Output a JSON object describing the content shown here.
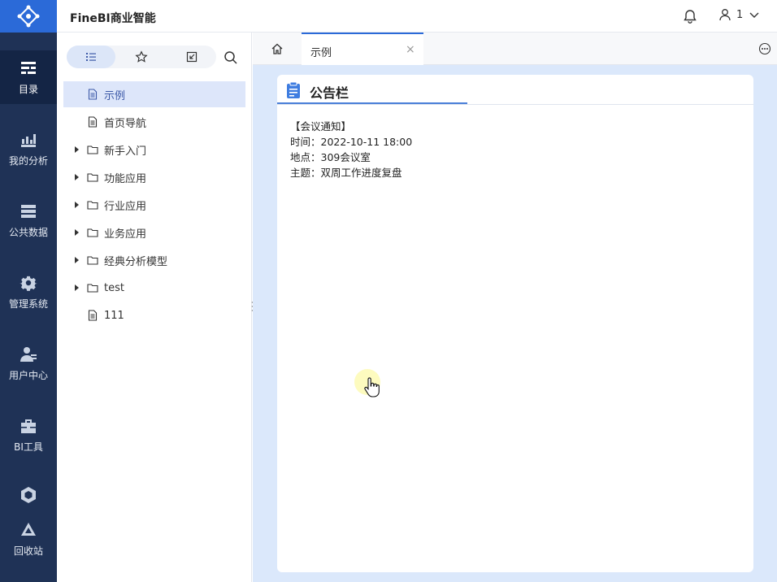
{
  "header": {
    "app_title": "FineBI商业智能",
    "user_name": "1"
  },
  "nav": {
    "items": [
      {
        "label": "目录",
        "icon": "catalog-icon",
        "active": true
      },
      {
        "label": "我的分析",
        "icon": "analysis-icon",
        "active": false
      },
      {
        "label": "公共数据",
        "icon": "database-icon",
        "active": false
      },
      {
        "label": "管理系统",
        "icon": "gear-icon",
        "active": false
      },
      {
        "label": "用户中心",
        "icon": "user-center-icon",
        "active": false
      },
      {
        "label": "BI工具",
        "icon": "toolbox-icon",
        "active": false
      },
      {
        "label": "",
        "icon": "cube-icon",
        "active": false
      },
      {
        "label": "回收站",
        "icon": "recycle-icon",
        "active": false
      }
    ]
  },
  "directory": {
    "tabs": [
      "list-icon",
      "star-icon",
      "import-icon"
    ],
    "items": [
      {
        "label": "示例",
        "type": "file",
        "selected": true
      },
      {
        "label": "首页导航",
        "type": "file",
        "selected": false
      },
      {
        "label": "新手入门",
        "type": "folder",
        "selected": false
      },
      {
        "label": "功能应用",
        "type": "folder",
        "selected": false
      },
      {
        "label": "行业应用",
        "type": "folder",
        "selected": false
      },
      {
        "label": "业务应用",
        "type": "folder",
        "selected": false
      },
      {
        "label": "经典分析模型",
        "type": "folder",
        "selected": false
      },
      {
        "label": "test",
        "type": "folder",
        "selected": false
      },
      {
        "label": "111",
        "type": "file",
        "selected": false
      }
    ]
  },
  "main": {
    "tab_label": "示例",
    "tab_close": "×",
    "card": {
      "title": "公告栏",
      "lines": [
        "【会议通知】",
        "时间：2022-10-11 18:00",
        "地点：309会议室",
        "主题：双周工作进度复盘"
      ]
    }
  },
  "colors": {
    "nav_bg": "#1f3256",
    "brand": "#2b6ad8",
    "main_bg": "#dbe8fb",
    "selected_bg": "#dde6fa"
  }
}
